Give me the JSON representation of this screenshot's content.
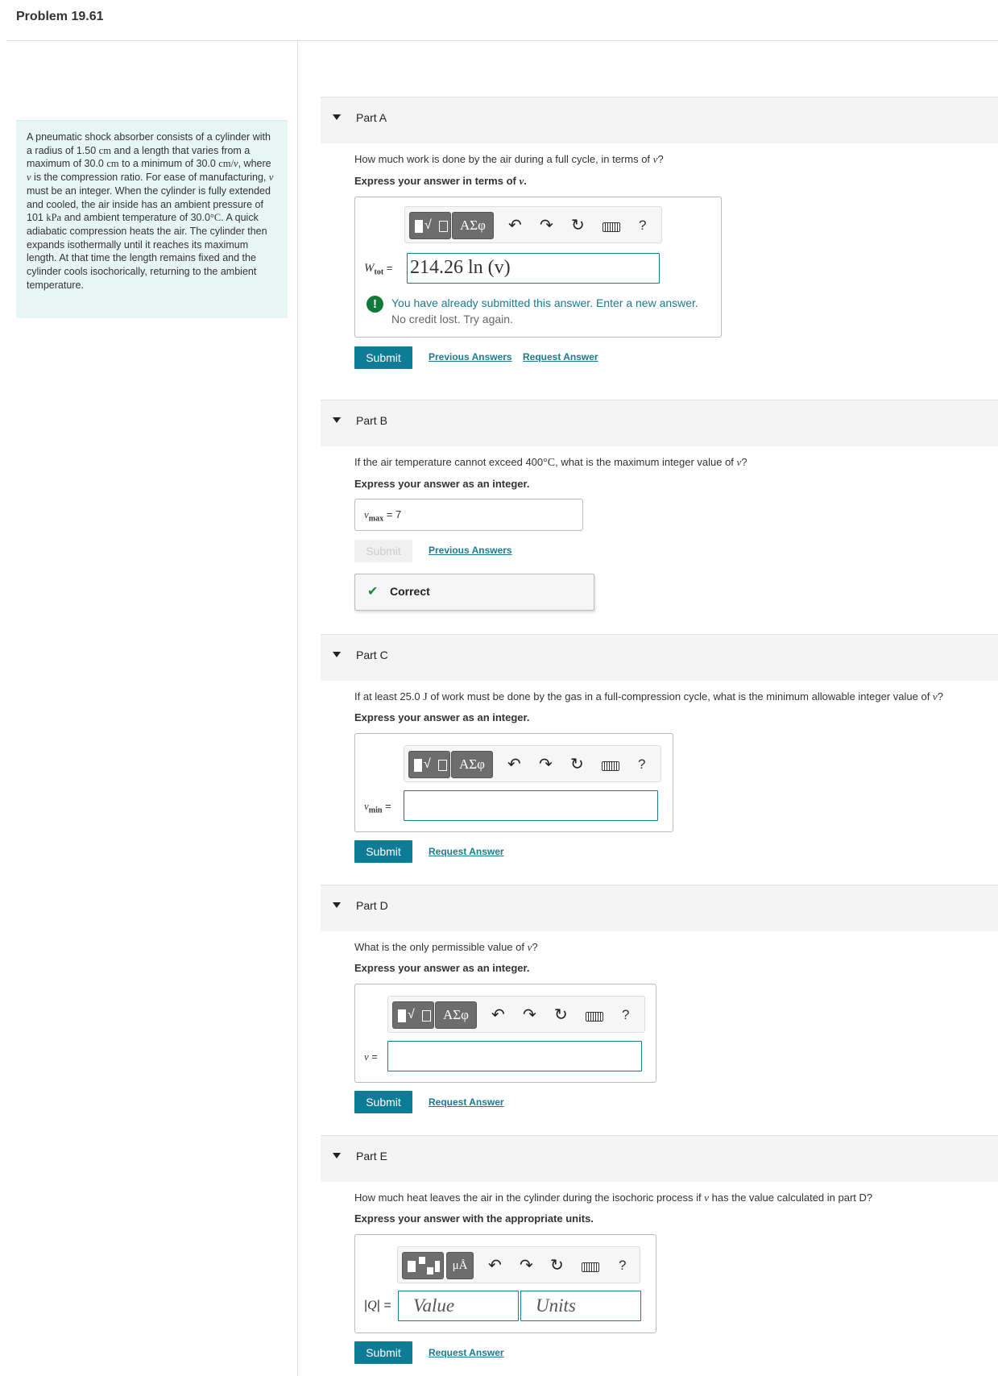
{
  "problem": {
    "title": "Problem 19.61",
    "text_1": "A pneumatic shock absorber consists of a cylinder with a radius of 1.50 ",
    "u_cm1": "cm",
    "text_2": " and a length that varies from a maximum of 30.0 ",
    "u_cm2": "cm",
    "text_3": " to a minimum of 30.0 ",
    "u_cmv": "cm/",
    "v1": "v",
    "text_4": ", where ",
    "v2": "v",
    "text_5": " is the compression ratio. For ease of manufacturing, ",
    "v3": "v",
    "text_6": " must be an integer. When the cylinder is fully extended and cooled, the air inside has an ambient pressure of 101 ",
    "u_kpa": "kPa",
    "text_7": " and ambient temperature of 30.0",
    "u_degc": "°C",
    "text_8": ". A quick adiabatic compression heats the air. The cylinder then expands isothermally until it reaches its maximum length. At that time the length remains fixed and the cylinder cools isochorically, returning to the ambient temperature."
  },
  "toolbar": {
    "sqrt_glyph": "√",
    "greek_label": "ΑΣφ",
    "mu_label": "μÅ",
    "undo_icon": "↶",
    "redo_icon": "↷",
    "reset_icon": "↻",
    "help_label": "?"
  },
  "parts": {
    "a": {
      "label": "Part A",
      "question_pre": "How much work is done by the air during a full cycle, in terms of ",
      "question_var": "v",
      "question_post": "?",
      "instruction_pre": "Express your answer in terms of ",
      "instruction_var": "v",
      "instruction_post": ".",
      "var_main": "W",
      "var_sub": "tot",
      "equals": " =",
      "input_value": "214.26 ln (v)",
      "warning_icon": "!",
      "warning": "You have already submitted this answer. Enter a new answer.",
      "warning_sub": "No credit lost. Try again.",
      "submit": "Submit",
      "link_prev": "Previous Answers",
      "link_request": "Request Answer"
    },
    "b": {
      "label": "Part B",
      "question_pre": "If the air temperature cannot exceed 400",
      "question_unit": "°C",
      "question_mid": ", what is the maximum integer value of ",
      "question_var": "v",
      "question_post": "?",
      "instruction": "Express your answer as an integer.",
      "var_main": "v",
      "var_sub": "max",
      "equals": " = ",
      "value": "7",
      "submit": "Submit",
      "link_prev": "Previous Answers",
      "check_icon": "✔",
      "feedback": "Correct"
    },
    "c": {
      "label": "Part C",
      "question_pre": "If at least 25.0 ",
      "question_unit": "J",
      "question_mid": " of work must be done by the gas in a full-compression cycle, what is the minimum allowable integer value of ",
      "question_var": "v",
      "question_post": "?",
      "instruction": "Express your answer as an integer.",
      "var_main": "v",
      "var_sub": "min",
      "equals": " =",
      "submit": "Submit",
      "link_request": "Request Answer"
    },
    "d": {
      "label": "Part D",
      "question_pre": "What is the only permissible value of ",
      "question_var": "v",
      "question_post": "?",
      "instruction": "Express your answer as an integer.",
      "var_main": "v",
      "equals": " =",
      "submit": "Submit",
      "link_request": "Request Answer"
    },
    "e": {
      "label": "Part E",
      "question_pre": "How much heat leaves the air in the cylinder during the isochoric process if ",
      "question_var": "v",
      "question_post": " has the value calculated in part D?",
      "instruction": "Express your answer with the appropriate units.",
      "var_bar1": "|",
      "var_main": "Q",
      "var_bar2": "| =",
      "value_placeholder": "Value",
      "units_placeholder": "Units",
      "submit": "Submit",
      "link_request": "Request Answer"
    }
  }
}
